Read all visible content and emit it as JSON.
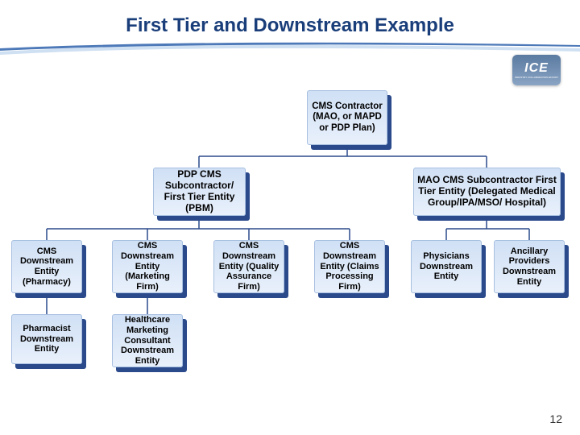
{
  "title": "First Tier and Downstream Example",
  "logo": {
    "main": "ICE",
    "sub": "INDUSTRY COLLABORATION EFFORT"
  },
  "slide_number": "12",
  "nodes": {
    "root": "CMS Contractor (MAO, or MAPD or PDP Plan)",
    "tier1_left": "PDP CMS Subcontractor/ First Tier Entity (PBM)",
    "tier1_right": "MAO CMS Subcontractor First Tier Entity (Delegated Medical Group/IPA/MSO/ Hospital)",
    "t2_1": "CMS Downstream Entity (Pharmacy)",
    "t2_2": "CMS Downstream Entity (Marketing Firm)",
    "t2_3": "CMS Downstream Entity (Quality Assurance Firm)",
    "t2_4": "CMS Downstream Entity (Claims Processing Firm)",
    "t2_5": "Physicians Downstream Entity",
    "t2_6": "Ancillary Providers Downstream Entity",
    "t3_1": "Pharmacist Downstream Entity",
    "t3_2": "Healthcare Marketing Consultant Downstream Entity"
  }
}
